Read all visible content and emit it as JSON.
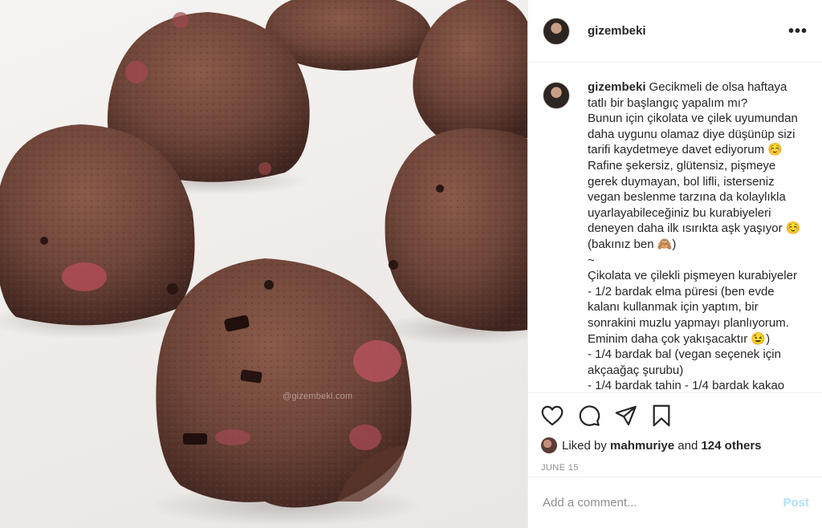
{
  "post": {
    "author": "gizembeki",
    "watermark": "@gizembeki.com"
  },
  "header": {
    "username": "gizembeki",
    "more_icon": "more-horizontal-icon",
    "more_label": "•••"
  },
  "caption": {
    "username": "gizembeki",
    "lines": [
      "Gecikmeli de olsa haftaya",
      "tatlı bir başlangıç yapalım mı?",
      "Bunun için çikolata ve çilek uyumundan",
      "daha uygunu olamaz diye düşünüp sizi",
      "tarifi kaydetmeye davet ediyorum ☺️",
      "Rafine şekersiz, glütensiz, pişmeye",
      "gerek duymayan, bol lifli, isterseniz",
      "vegan beslenme tarzına da kolaylıkla",
      "uyarlayabileceğiniz bu kurabiyeleri",
      "deneyen daha ilk ısırıkta aşk yaşıyor ☺️",
      "(bakınız ben 🙈)",
      "~",
      "Çikolata ve çilekli pişmeyen kurabiyeler",
      "- 1/2 bardak elma püresi (ben evde",
      "kalanı kullanmak için yaptım, bir",
      "sonrakini muzlu yapmayı planlıyorum.",
      "Eminim daha çok yakışacaktır 😉)",
      "- 1/4 bardak bal (vegan seçenek için",
      "akçaağaç şurubu)",
      "- 1/4 bardak tahin - 1/4 bardak kakao"
    ]
  },
  "actions": {
    "like_icon": "heart-icon",
    "comment_icon": "comment-icon",
    "share_icon": "share-icon",
    "save_icon": "bookmark-icon"
  },
  "likes": {
    "prefix": "Liked by",
    "user": "mahmuriye",
    "conjunction": "and",
    "others": "124 others"
  },
  "date": "JUNE 15",
  "comment": {
    "placeholder": "Add a comment...",
    "post_label": "Post"
  }
}
